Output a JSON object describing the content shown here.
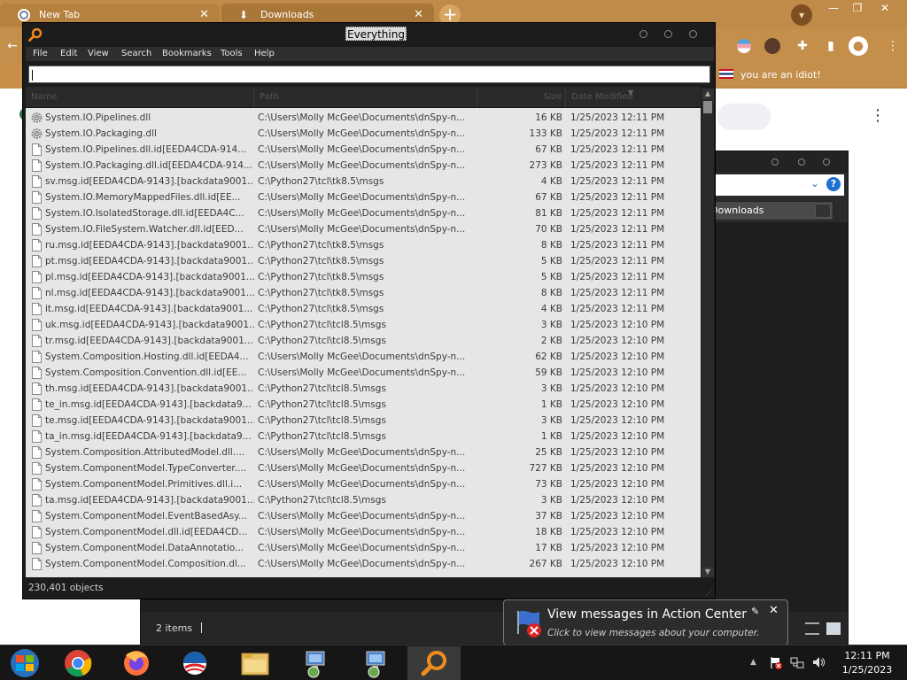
{
  "chrome": {
    "tabs": [
      {
        "label": "New Tab"
      },
      {
        "label": "Downloads"
      }
    ],
    "bookmark_label": "you are an idiot!"
  },
  "downloads_window": {
    "search_value": "Downloads",
    "status": "2 items"
  },
  "everything": {
    "title": "Everything",
    "menu": [
      "File",
      "Edit",
      "View",
      "Search",
      "Bookmarks",
      "Tools",
      "Help"
    ],
    "search_value": "",
    "columns": [
      "Name",
      "Path",
      "Size",
      "Date Modified"
    ],
    "rows": [
      {
        "name": "System.IO.Pipelines.dll",
        "path": "C:\\Users\\Molly McGee\\Documents\\dnSpy-n...",
        "size": "16 KB",
        "date": "1/25/2023 12:11 PM",
        "icon": "gear"
      },
      {
        "name": "System.IO.Packaging.dll",
        "path": "C:\\Users\\Molly McGee\\Documents\\dnSpy-n...",
        "size": "133 KB",
        "date": "1/25/2023 12:11 PM",
        "icon": "gear"
      },
      {
        "name": "System.IO.Pipelines.dll.id[EEDA4CDA-914...",
        "path": "C:\\Users\\Molly McGee\\Documents\\dnSpy-n...",
        "size": "67 KB",
        "date": "1/25/2023 12:11 PM",
        "icon": "file"
      },
      {
        "name": "System.IO.Packaging.dll.id[EEDA4CDA-914...",
        "path": "C:\\Users\\Molly McGee\\Documents\\dnSpy-n...",
        "size": "273 KB",
        "date": "1/25/2023 12:11 PM",
        "icon": "file"
      },
      {
        "name": "sv.msg.id[EEDA4CDA-9143].[backdata9001...",
        "path": "C:\\Python27\\tcl\\tk8.5\\msgs",
        "size": "4 KB",
        "date": "1/25/2023 12:11 PM",
        "icon": "file"
      },
      {
        "name": "System.IO.MemoryMappedFiles.dll.id[EE...",
        "path": "C:\\Users\\Molly McGee\\Documents\\dnSpy-n...",
        "size": "67 KB",
        "date": "1/25/2023 12:11 PM",
        "icon": "file"
      },
      {
        "name": "System.IO.IsolatedStorage.dll.id[EEDA4C...",
        "path": "C:\\Users\\Molly McGee\\Documents\\dnSpy-n...",
        "size": "81 KB",
        "date": "1/25/2023 12:11 PM",
        "icon": "file"
      },
      {
        "name": "System.IO.FileSystem.Watcher.dll.id[EED...",
        "path": "C:\\Users\\Molly McGee\\Documents\\dnSpy-n...",
        "size": "70 KB",
        "date": "1/25/2023 12:11 PM",
        "icon": "file"
      },
      {
        "name": "ru.msg.id[EEDA4CDA-9143].[backdata9001...",
        "path": "C:\\Python27\\tcl\\tk8.5\\msgs",
        "size": "8 KB",
        "date": "1/25/2023 12:11 PM",
        "icon": "file"
      },
      {
        "name": "pt.msg.id[EEDA4CDA-9143].[backdata9001...",
        "path": "C:\\Python27\\tcl\\tk8.5\\msgs",
        "size": "5 KB",
        "date": "1/25/2023 12:11 PM",
        "icon": "file"
      },
      {
        "name": "pl.msg.id[EEDA4CDA-9143].[backdata9001...",
        "path": "C:\\Python27\\tcl\\tk8.5\\msgs",
        "size": "5 KB",
        "date": "1/25/2023 12:11 PM",
        "icon": "file"
      },
      {
        "name": "nl.msg.id[EEDA4CDA-9143].[backdata9001...",
        "path": "C:\\Python27\\tcl\\tk8.5\\msgs",
        "size": "8 KB",
        "date": "1/25/2023 12:11 PM",
        "icon": "file"
      },
      {
        "name": "it.msg.id[EEDA4CDA-9143].[backdata9001...",
        "path": "C:\\Python27\\tcl\\tk8.5\\msgs",
        "size": "4 KB",
        "date": "1/25/2023 12:11 PM",
        "icon": "file"
      },
      {
        "name": "uk.msg.id[EEDA4CDA-9143].[backdata9001...",
        "path": "C:\\Python27\\tcl\\tcl8.5\\msgs",
        "size": "3 KB",
        "date": "1/25/2023 12:10 PM",
        "icon": "file"
      },
      {
        "name": "tr.msg.id[EEDA4CDA-9143].[backdata9001...",
        "path": "C:\\Python27\\tcl\\tcl8.5\\msgs",
        "size": "2 KB",
        "date": "1/25/2023 12:10 PM",
        "icon": "file"
      },
      {
        "name": "System.Composition.Hosting.dll.id[EEDA4...",
        "path": "C:\\Users\\Molly McGee\\Documents\\dnSpy-n...",
        "size": "62 KB",
        "date": "1/25/2023 12:10 PM",
        "icon": "file"
      },
      {
        "name": "System.Composition.Convention.dll.id[EE...",
        "path": "C:\\Users\\Molly McGee\\Documents\\dnSpy-n...",
        "size": "59 KB",
        "date": "1/25/2023 12:10 PM",
        "icon": "file"
      },
      {
        "name": "th.msg.id[EEDA4CDA-9143].[backdata9001...",
        "path": "C:\\Python27\\tcl\\tcl8.5\\msgs",
        "size": "3 KB",
        "date": "1/25/2023 12:10 PM",
        "icon": "file"
      },
      {
        "name": "te_in.msg.id[EEDA4CDA-9143].[backdata9...",
        "path": "C:\\Python27\\tcl\\tcl8.5\\msgs",
        "size": "1 KB",
        "date": "1/25/2023 12:10 PM",
        "icon": "file"
      },
      {
        "name": "te.msg.id[EEDA4CDA-9143].[backdata9001...",
        "path": "C:\\Python27\\tcl\\tcl8.5\\msgs",
        "size": "3 KB",
        "date": "1/25/2023 12:10 PM",
        "icon": "file"
      },
      {
        "name": "ta_in.msg.id[EEDA4CDA-9143].[backdata9...",
        "path": "C:\\Python27\\tcl\\tcl8.5\\msgs",
        "size": "1 KB",
        "date": "1/25/2023 12:10 PM",
        "icon": "file"
      },
      {
        "name": "System.Composition.AttributedModel.dll....",
        "path": "C:\\Users\\Molly McGee\\Documents\\dnSpy-n...",
        "size": "25 KB",
        "date": "1/25/2023 12:10 PM",
        "icon": "file"
      },
      {
        "name": "System.ComponentModel.TypeConverter....",
        "path": "C:\\Users\\Molly McGee\\Documents\\dnSpy-n...",
        "size": "727 KB",
        "date": "1/25/2023 12:10 PM",
        "icon": "file"
      },
      {
        "name": "System.ComponentModel.Primitives.dll.i...",
        "path": "C:\\Users\\Molly McGee\\Documents\\dnSpy-n...",
        "size": "73 KB",
        "date": "1/25/2023 12:10 PM",
        "icon": "file"
      },
      {
        "name": "ta.msg.id[EEDA4CDA-9143].[backdata9001...",
        "path": "C:\\Python27\\tcl\\tcl8.5\\msgs",
        "size": "3 KB",
        "date": "1/25/2023 12:10 PM",
        "icon": "file"
      },
      {
        "name": "System.ComponentModel.EventBasedAsy...",
        "path": "C:\\Users\\Molly McGee\\Documents\\dnSpy-n...",
        "size": "37 KB",
        "date": "1/25/2023 12:10 PM",
        "icon": "file"
      },
      {
        "name": "System.ComponentModel.dll.id[EEDA4CD...",
        "path": "C:\\Users\\Molly McGee\\Documents\\dnSpy-n...",
        "size": "18 KB",
        "date": "1/25/2023 12:10 PM",
        "icon": "file"
      },
      {
        "name": "System.ComponentModel.DataAnnotatio...",
        "path": "C:\\Users\\Molly McGee\\Documents\\dnSpy-n...",
        "size": "17 KB",
        "date": "1/25/2023 12:10 PM",
        "icon": "file"
      },
      {
        "name": "System.ComponentModel.Composition.dl...",
        "path": "C:\\Users\\Molly McGee\\Documents\\dnSpy-n...",
        "size": "267 KB",
        "date": "1/25/2023 12:10 PM",
        "icon": "file"
      }
    ],
    "status": "230,401 objects"
  },
  "balloon": {
    "title": "View messages in Action Center",
    "subtitle": "Click to view messages about your computer."
  },
  "taskbar": {
    "apps": [
      "windows-start",
      "chrome",
      "firefox",
      "obama-logo",
      "file-explorer",
      "network-app-1",
      "network-app-2",
      "everything"
    ],
    "clock_time": "12:11 PM",
    "clock_date": "1/25/2023"
  },
  "colors": {
    "desktop": "#c9924a",
    "list_bg": "#e6e6e6",
    "window_dark": "#1c1c1c",
    "accent_orange": "#f08c1e"
  }
}
